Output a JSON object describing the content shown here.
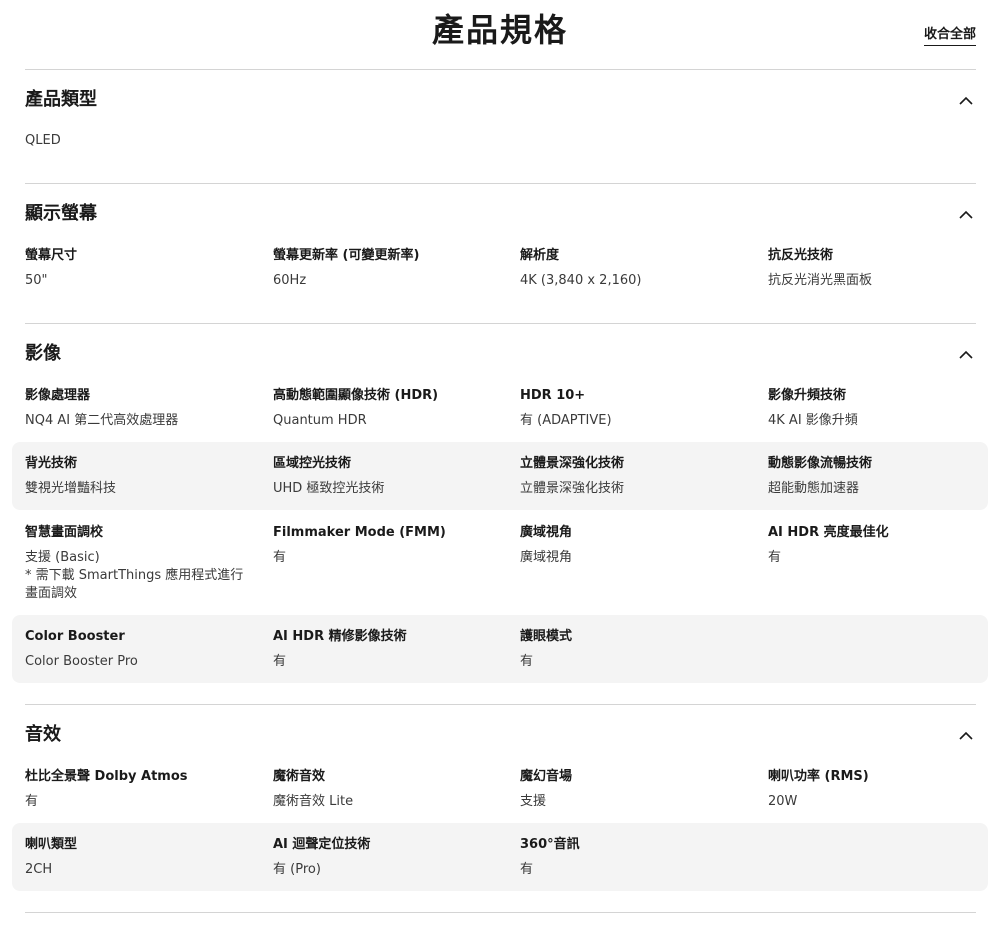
{
  "header": {
    "title": "產品規格",
    "collapse_all": "收合全部"
  },
  "sections": {
    "type": {
      "title": "產品類型",
      "value": "QLED"
    },
    "display": {
      "title": "顯示螢幕",
      "specs": [
        {
          "label": "螢幕尺寸",
          "value": "50\""
        },
        {
          "label": "螢幕更新率 (可變更新率)",
          "value": "60Hz"
        },
        {
          "label": "解析度",
          "value": "4K (3,840 x 2,160)"
        },
        {
          "label": "抗反光技術",
          "value": "抗反光消光黑面板"
        }
      ]
    },
    "video": {
      "title": "影像",
      "specs": [
        {
          "label": "影像處理器",
          "value": "NQ4 AI 第二代高效處理器"
        },
        {
          "label": "高動態範圍顯像技術 (HDR)",
          "value": "Quantum HDR"
        },
        {
          "label": "HDR 10+",
          "value": "有 (ADAPTIVE)"
        },
        {
          "label": "影像升頻技術",
          "value": "4K AI 影像升頻"
        },
        {
          "label": "背光技術",
          "value": "雙視光增豔科技"
        },
        {
          "label": "區域控光技術",
          "value": "UHD 極致控光技術"
        },
        {
          "label": "立體景深強化技術",
          "value": "立體景深強化技術"
        },
        {
          "label": "動態影像流暢技術",
          "value": "超能動態加速器"
        },
        {
          "label": "智慧畫面調校",
          "value": "支援 (Basic)\n* 需下載 SmartThings 應用程式進行\n畫面調效"
        },
        {
          "label": "Filmmaker Mode (FMM)",
          "value": "有"
        },
        {
          "label": "廣域視角",
          "value": "廣域視角"
        },
        {
          "label": "AI HDR 亮度最佳化",
          "value": "有"
        },
        {
          "label": "Color Booster",
          "value": "Color Booster Pro"
        },
        {
          "label": "AI HDR 精修影像技術",
          "value": "有"
        },
        {
          "label": "護眼模式",
          "value": "有"
        }
      ]
    },
    "audio": {
      "title": "音效",
      "specs": [
        {
          "label": "杜比全景聲 Dolby Atmos",
          "value": "有"
        },
        {
          "label": "魔術音效",
          "value": "魔術音效 Lite"
        },
        {
          "label": "魔幻音場",
          "value": "支援"
        },
        {
          "label": "喇叭功率 (RMS)",
          "value": "20W"
        },
        {
          "label": "喇叭類型",
          "value": "2CH"
        },
        {
          "label": "AI 迴聲定位技術",
          "value": "有 (Pro)"
        },
        {
          "label": "360°音訊",
          "value": "有"
        }
      ]
    }
  },
  "icons": {
    "section_toggle": "chevron-up-icon"
  },
  "colors": {
    "divider": "#d4d4d4",
    "row_shade": "#f4f4f4",
    "text": "#1a1a1a"
  }
}
